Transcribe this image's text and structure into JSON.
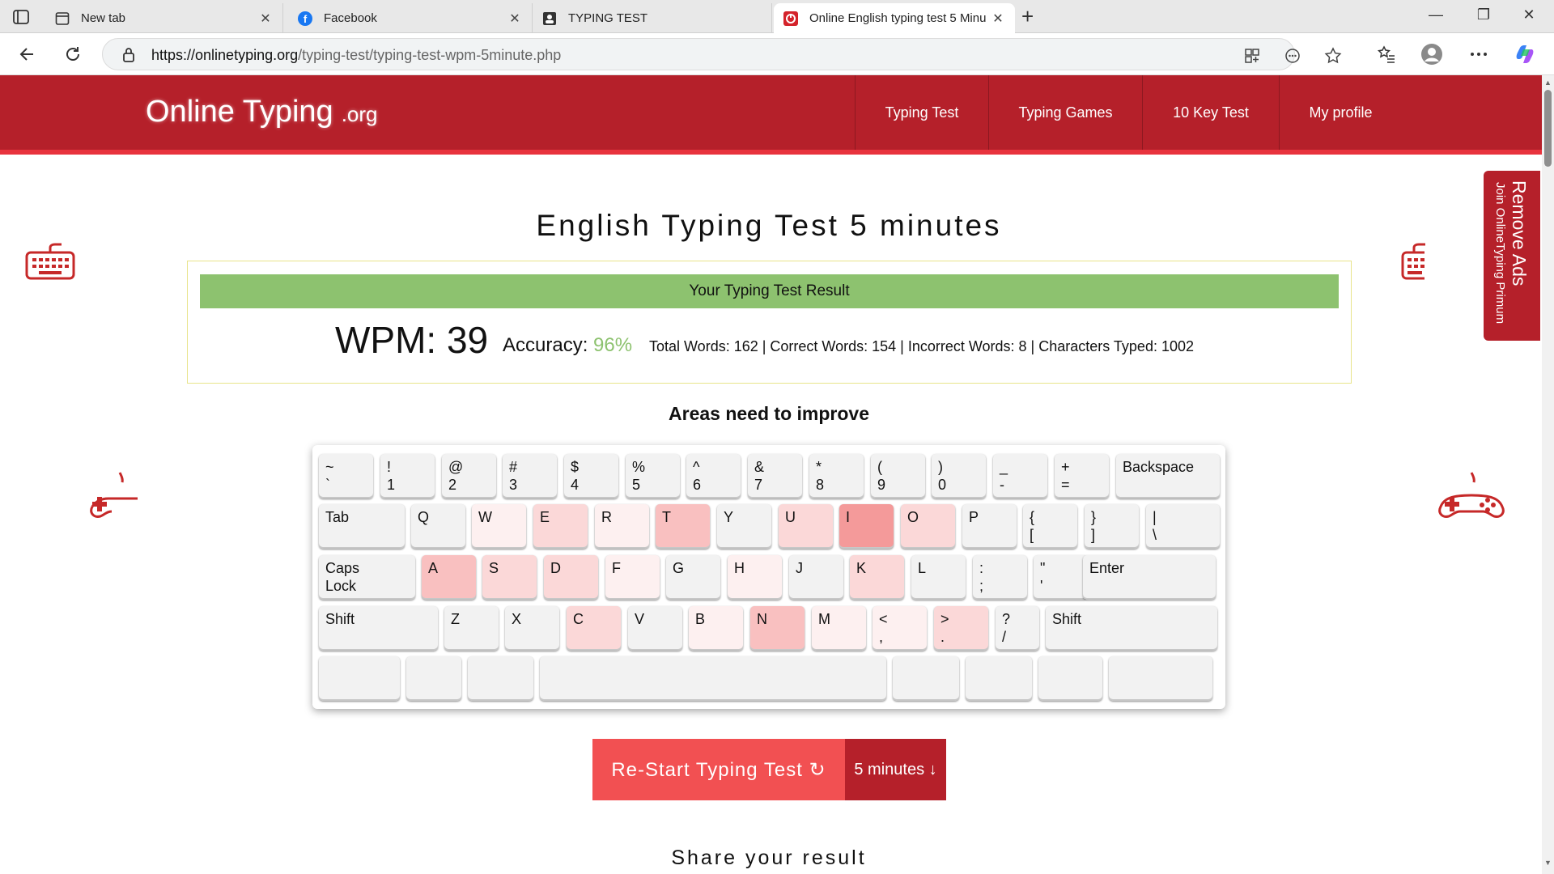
{
  "browser": {
    "tabs": [
      {
        "title": "New tab",
        "icon": "newtab-icon"
      },
      {
        "title": "Facebook",
        "icon": "facebook-icon"
      },
      {
        "title": "TYPING TEST",
        "icon": "typing-test-icon"
      },
      {
        "title": "Online English typing test 5 Minu",
        "icon": "onlinetyping-icon"
      }
    ],
    "url_domain": "https://onlinetyping.org",
    "url_path": "/typing-test/typing-test-wpm-5minute.php"
  },
  "site": {
    "logo": "Online Typing",
    "logo_suffix": ".org",
    "nav": [
      "Typing Test",
      "Typing Games",
      "10 Key Test",
      "My profile"
    ]
  },
  "remove_ads": {
    "title": "Remove Ads",
    "subtitle": "Join OnlineTyping Primum"
  },
  "page": {
    "title": "English Typing Test 5 minutes",
    "result_banner": "Your Typing Test Result",
    "wpm": "WPM: 39",
    "accuracy_label": "Accuracy:",
    "accuracy_value": "96%",
    "stats": "Total Words: 162 | Correct Words: 154 | Incorrect Words: 8 | Characters Typed: 1002",
    "improve_title": "Areas need to improve",
    "restart_label": "Re-Start Typing Test ↻",
    "duration_label": "5 minutes ↓",
    "share_title": "Share your result"
  },
  "keyboard": {
    "heat_colors": [
      "#f2f2f2",
      "#fdf0f0",
      "#fbd8d8",
      "#f9c0c0",
      "#f49a9a"
    ],
    "rows": [
      [
        {
          "label": "~\n`",
          "heat": 0
        },
        {
          "label": "!\n1",
          "heat": 0
        },
        {
          "label": "@\n2",
          "heat": 0
        },
        {
          "label": "#\n3",
          "heat": 0
        },
        {
          "label": "$\n4",
          "heat": 0
        },
        {
          "label": "%\n5",
          "heat": 0
        },
        {
          "label": "^\n6",
          "heat": 0
        },
        {
          "label": "&\n7",
          "heat": 0
        },
        {
          "label": "*\n8",
          "heat": 0
        },
        {
          "label": "(\n9",
          "heat": 0
        },
        {
          "label": ")\n0",
          "heat": 0
        },
        {
          "label": "_\n-",
          "heat": 0
        },
        {
          "label": "+\n=",
          "heat": 0
        },
        {
          "label": "Backspace",
          "heat": 0
        }
      ],
      [
        {
          "label": "Tab",
          "heat": 0
        },
        {
          "label": "Q",
          "heat": 0
        },
        {
          "label": "W",
          "heat": 1
        },
        {
          "label": "E",
          "heat": 2
        },
        {
          "label": "R",
          "heat": 1
        },
        {
          "label": "T",
          "heat": 3
        },
        {
          "label": "Y",
          "heat": 0
        },
        {
          "label": "U",
          "heat": 2
        },
        {
          "label": "I",
          "heat": 4
        },
        {
          "label": "O",
          "heat": 2
        },
        {
          "label": "P",
          "heat": 0
        },
        {
          "label": "{\n[",
          "heat": 0
        },
        {
          "label": "}\n]",
          "heat": 0
        },
        {
          "label": "|\n\\",
          "heat": 0
        }
      ],
      [
        {
          "label": "Caps\nLock",
          "heat": 0
        },
        {
          "label": "A",
          "heat": 3
        },
        {
          "label": "S",
          "heat": 2
        },
        {
          "label": "D",
          "heat": 2
        },
        {
          "label": "F",
          "heat": 1
        },
        {
          "label": "G",
          "heat": 0
        },
        {
          "label": "H",
          "heat": 1
        },
        {
          "label": "J",
          "heat": 0
        },
        {
          "label": "K",
          "heat": 2
        },
        {
          "label": "L",
          "heat": 0
        },
        {
          "label": ":\n;",
          "heat": 0
        },
        {
          "label": "\"\n'",
          "heat": 0
        },
        {
          "label": "Enter",
          "heat": 0
        }
      ],
      [
        {
          "label": "Shift",
          "heat": 0
        },
        {
          "label": "Z",
          "heat": 0
        },
        {
          "label": "X",
          "heat": 0
        },
        {
          "label": "C",
          "heat": 2
        },
        {
          "label": "V",
          "heat": 0
        },
        {
          "label": "B",
          "heat": 1
        },
        {
          "label": "N",
          "heat": 3
        },
        {
          "label": "M",
          "heat": 1
        },
        {
          "label": "<\n,",
          "heat": 1
        },
        {
          "label": ">\n.",
          "heat": 2
        },
        {
          "label": "?\n/",
          "heat": 0
        },
        {
          "label": "Shift",
          "heat": 0
        }
      ],
      [
        {
          "label": "",
          "heat": 0
        },
        {
          "label": "",
          "heat": 0
        },
        {
          "label": "",
          "heat": 0
        },
        {
          "label": "",
          "heat": 0
        },
        {
          "label": "",
          "heat": 0
        },
        {
          "label": "",
          "heat": 0
        },
        {
          "label": "",
          "heat": 0
        },
        {
          "label": "",
          "heat": 0
        }
      ]
    ]
  },
  "colors": {
    "brand_red": "#b5202a",
    "button_red": "#f25052",
    "result_green": "#8dc26f"
  }
}
